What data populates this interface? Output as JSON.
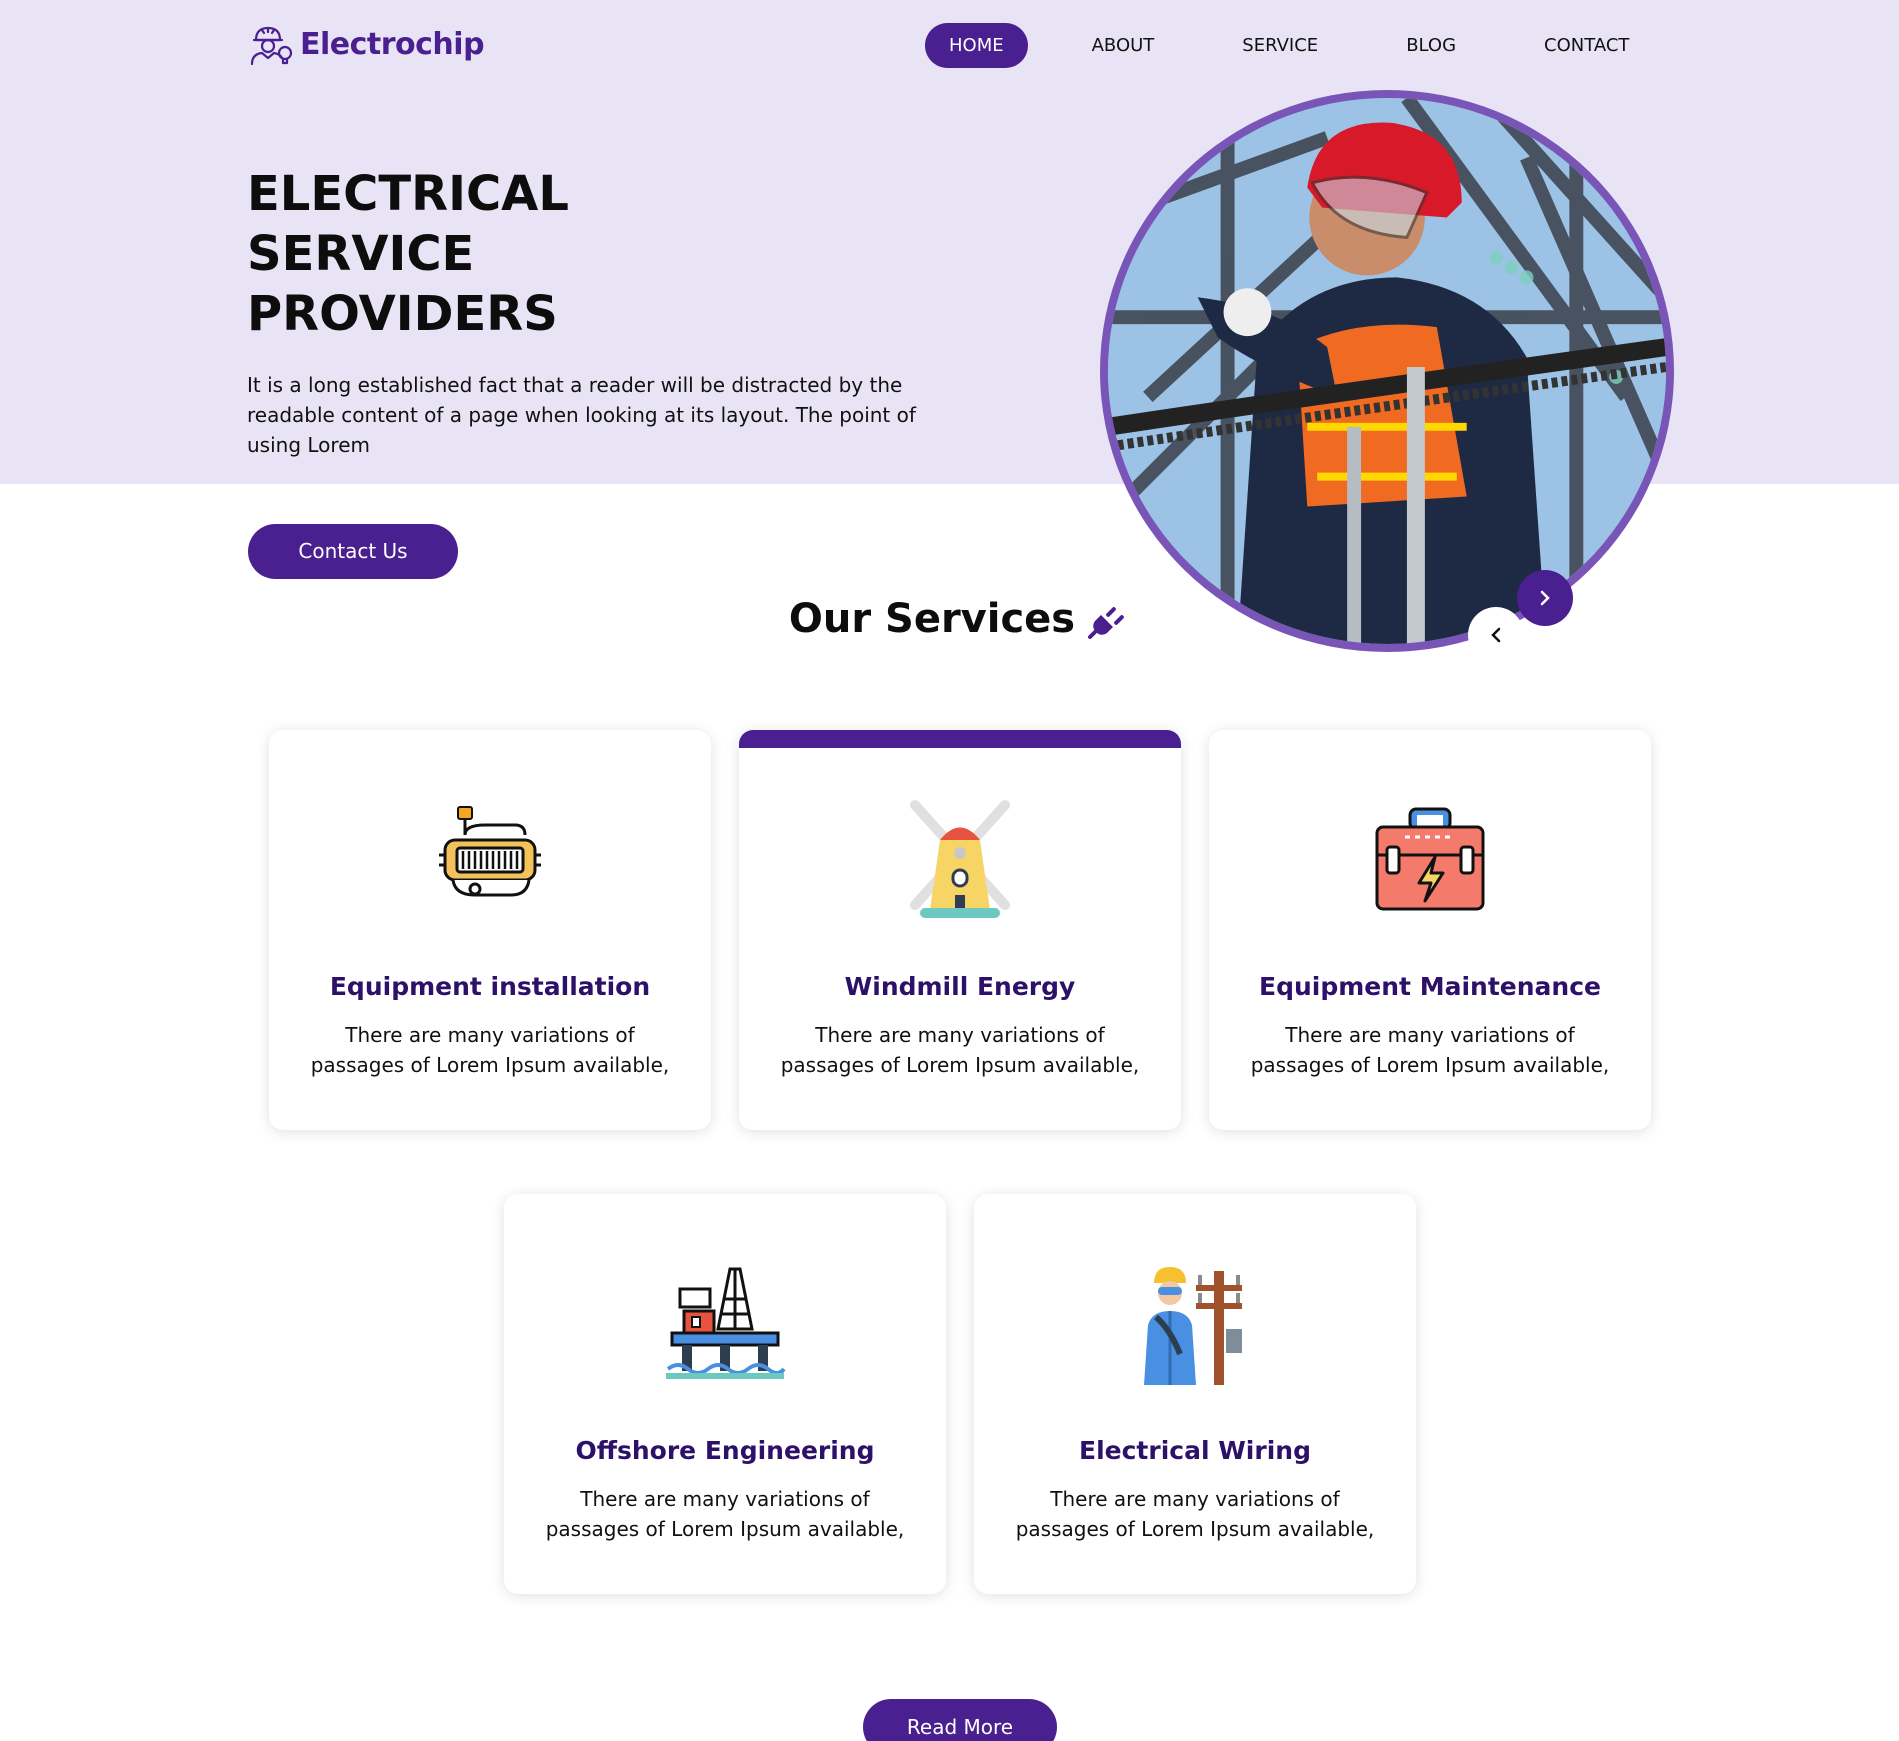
{
  "brand": {
    "name": "Electrochip",
    "accent": "#4a1f8f",
    "hero_bg": "#e8e4f5"
  },
  "nav": {
    "items": [
      {
        "label": "HOME",
        "active": true
      },
      {
        "label": "ABOUT",
        "active": false
      },
      {
        "label": "SERVICE",
        "active": false
      },
      {
        "label": "BLOG",
        "active": false
      },
      {
        "label": "CONTACT",
        "active": false
      }
    ]
  },
  "hero": {
    "title_lines": [
      "ELECTRICAL",
      "SERVICE",
      "PROVIDERS"
    ],
    "description": "It is a long established fact that a reader will be distracted by the readable content of a page when looking at its layout. The point of using Lorem",
    "cta_label": "Contact Us",
    "image_icon": "electrician-photo",
    "next_icon": "chevron-right-icon",
    "prev_icon": "chevron-left-icon"
  },
  "services": {
    "heading": "Our Services",
    "heading_icon": "plug-icon",
    "cards": [
      {
        "title": "Equipment installation",
        "description": "There are many variations of passages of Lorem Ipsum available,",
        "icon": "electric-equipment-icon",
        "highlight": false
      },
      {
        "title": "Windmill Energy",
        "description": "There are many variations of passages of Lorem Ipsum available,",
        "icon": "windmill-icon",
        "highlight": true
      },
      {
        "title": "Equipment Maintenance",
        "description": "There are many variations of passages of Lorem Ipsum available,",
        "icon": "toolbox-icon",
        "highlight": false
      },
      {
        "title": "Offshore Engineering",
        "description": "There are many variations of passages of Lorem Ipsum available,",
        "icon": "oil-platform-icon",
        "highlight": false
      },
      {
        "title": "Electrical Wiring",
        "description": "There are many variations of passages of Lorem Ipsum available,",
        "icon": "electrician-pole-icon",
        "highlight": false
      }
    ],
    "read_more_label": "Read More"
  }
}
